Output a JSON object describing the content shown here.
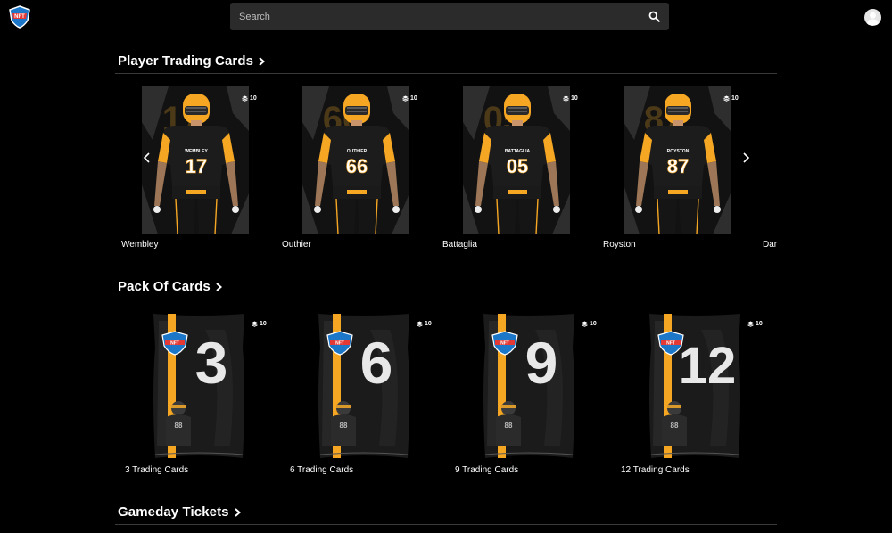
{
  "search": {
    "placeholder": "Search"
  },
  "sections": {
    "player_cards": {
      "title": "Player Trading Cards",
      "cards": [
        {
          "name": "Wembley",
          "number": "17",
          "jersey_name": "WEMBLEY",
          "count": "10"
        },
        {
          "name": "Outhier",
          "number": "66",
          "jersey_name": "OUTHIER",
          "count": "10"
        },
        {
          "name": "Battaglia",
          "number": "05",
          "jersey_name": "BATTAGLIA",
          "count": "10"
        },
        {
          "name": "Royston",
          "number": "87",
          "jersey_name": "ROYSTON",
          "count": "10"
        },
        {
          "name": "Dan",
          "number": "",
          "jersey_name": "",
          "count": ""
        }
      ]
    },
    "packs": {
      "title": "Pack Of Cards",
      "cards": [
        {
          "name": "3 Trading Cards",
          "number": "3",
          "count": "10"
        },
        {
          "name": "6 Trading Cards",
          "number": "6",
          "count": "10"
        },
        {
          "name": "9 Trading Cards",
          "number": "9",
          "count": "10"
        },
        {
          "name": "12 Trading Cards",
          "number": "12",
          "count": "10"
        }
      ]
    },
    "tickets": {
      "title": "Gameday Tickets"
    }
  },
  "logo": {
    "text": "NFT"
  },
  "colors": {
    "accent": "#f5a623",
    "background": "#000000",
    "search_bg": "#2b2b2b"
  },
  "icons": {
    "search": "search-icon",
    "avatar": "user-avatar-icon",
    "chevron": "chevron-right-icon",
    "prev": "chevron-left-icon",
    "stack": "stack-icon"
  }
}
